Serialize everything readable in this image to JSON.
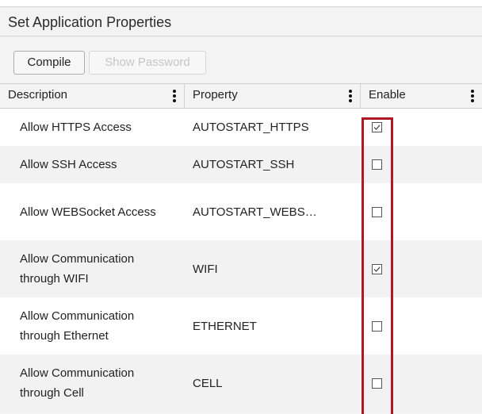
{
  "panel": {
    "title": "Set Application Properties"
  },
  "toolbar": {
    "compile_label": "Compile",
    "show_password_label": "Show Password"
  },
  "grid": {
    "columns": [
      {
        "label": "Description"
      },
      {
        "label": "Property"
      },
      {
        "label": "Enable"
      }
    ],
    "rows": [
      {
        "description": "Allow HTTPS Access",
        "property": "AUTOSTART_HTTPS",
        "enabled": true
      },
      {
        "description": "Allow SSH Access",
        "property": "AUTOSTART_SSH",
        "enabled": false
      },
      {
        "description": "Allow WEBSocket Access",
        "property": "AUTOSTART_WEBS…",
        "enabled": false
      },
      {
        "description": "Allow Communication through WIFI",
        "property": "WIFI",
        "enabled": true
      },
      {
        "description": "Allow Communication through Ethernet",
        "property": "ETHERNET",
        "enabled": false
      },
      {
        "description": "Allow Communication through Cell",
        "property": "CELL",
        "enabled": false
      }
    ]
  },
  "colors": {
    "highlight": "#b01722",
    "row_alt": "#f2f2f2"
  }
}
